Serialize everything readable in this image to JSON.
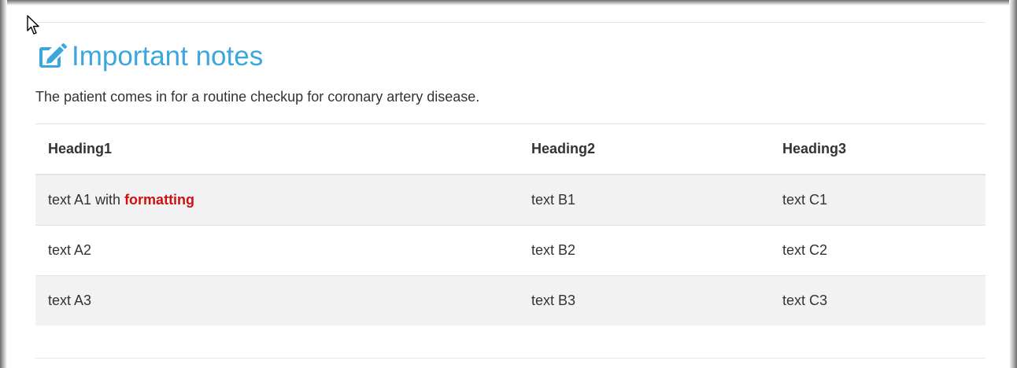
{
  "section": {
    "title": "Important notes",
    "icon": "edit-note-icon",
    "accent_color": "#3aa7dd",
    "description": "The patient comes in for a routine checkup for coronary artery disease."
  },
  "table": {
    "headers": [
      "Heading1",
      "Heading2",
      "Heading3"
    ],
    "rows": [
      {
        "a_plain": "text A1 with ",
        "a_emphasis": "formatting",
        "b": "text B1",
        "c": "text C1"
      },
      {
        "a_plain": "text A2",
        "a_emphasis": "",
        "b": "text B2",
        "c": "text C2"
      },
      {
        "a_plain": "text A3",
        "a_emphasis": "",
        "b": "text B3",
        "c": "text C3"
      }
    ],
    "emphasis_color": "#cc1111",
    "stripe_color": "#f2f2f2"
  }
}
